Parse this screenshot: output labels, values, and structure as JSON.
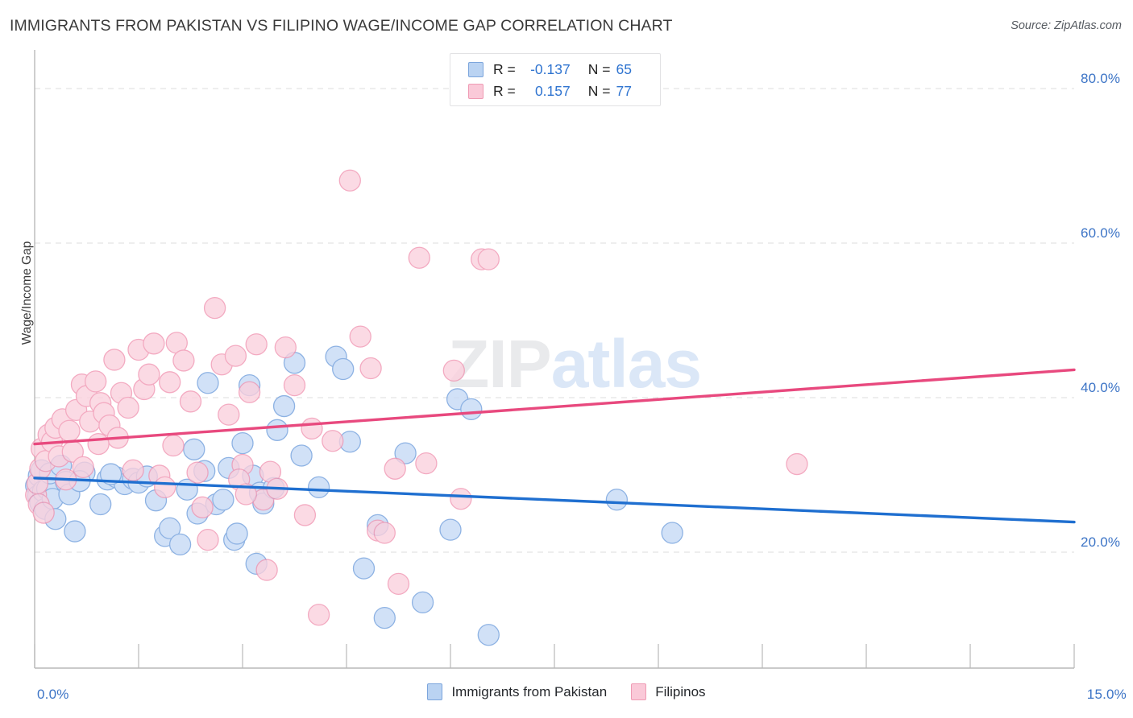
{
  "header": {
    "title": "IMMIGRANTS FROM PAKISTAN VS FILIPINO WAGE/INCOME GAP CORRELATION CHART",
    "source": "Source: ZipAtlas.com"
  },
  "watermark": {
    "part1": "ZIP",
    "part2": "atlas"
  },
  "stats_legend": {
    "rows": [
      {
        "series": "Immigrants from Pakistan",
        "color": "#bad3f2",
        "r_label": "R =",
        "r_value": "-0.137",
        "n_label": "N =",
        "n_value": "65"
      },
      {
        "series": "Filipinos",
        "color": "#fac9d8",
        "r_label": "R =",
        "r_value": "0.157",
        "n_label": "N =",
        "n_value": "77"
      }
    ]
  },
  "bottom_legend": {
    "items": [
      {
        "label": "Immigrants from Pakistan",
        "color": "#bad3f2",
        "border": "#7ca5dc"
      },
      {
        "label": "Filipinos",
        "color": "#fac9d8",
        "border": "#ef9bb4"
      }
    ]
  },
  "chart_data": {
    "type": "scatter",
    "title": "IMMIGRANTS FROM PAKISTAN VS FILIPINO WAGE/INCOME GAP CORRELATION CHART",
    "xlabel": "",
    "ylabel": "Wage/Income Gap",
    "xlim": [
      0,
      15
    ],
    "ylim": [
      5.0,
      85.0
    ],
    "x_ticks": [
      0,
      15
    ],
    "x_tick_labels": [
      "0.0%",
      "15.0%"
    ],
    "y_ticks": [
      20,
      40,
      60,
      80
    ],
    "y_tick_labels": [
      "20.0%",
      "40.0%",
      "60.0%",
      "80.0%"
    ],
    "grid": true,
    "grid_axis": "y",
    "legend_position": "bottom",
    "marker_radius_px": 13,
    "colors": {
      "blue_fill": "#c5d9f5",
      "blue_stroke": "#6e9ddc",
      "pink_fill": "#fbd0dd",
      "pink_stroke": "#f093b0",
      "blue_line": "#1f6fd0",
      "pink_line": "#e8497e",
      "grid": "#dcdcdc",
      "axis": "#b9b9b9",
      "tick_text": "#3c74c6"
    },
    "series": [
      {
        "name": "Immigrants from Pakistan",
        "color": "#c5d9f5",
        "stroke": "#6e9ddc",
        "r": -0.137,
        "n": 65,
        "trendline": {
          "x0": 0,
          "y0": 29.6,
          "x1": 15,
          "y1": 23.9
        },
        "points": [
          [
            0.02,
            28.6
          ],
          [
            0.05,
            27.3
          ],
          [
            0.06,
            29.9
          ],
          [
            0.08,
            26.4
          ],
          [
            0.1,
            30.6
          ],
          [
            0.12,
            27.9
          ],
          [
            0.15,
            25.6
          ],
          [
            0.18,
            28.2
          ],
          [
            0.22,
            30.2
          ],
          [
            0.26,
            26.9
          ],
          [
            0.3,
            24.3
          ],
          [
            0.38,
            31.2
          ],
          [
            0.45,
            29.1
          ],
          [
            0.5,
            27.5
          ],
          [
            0.58,
            22.7
          ],
          [
            0.72,
            30.3
          ],
          [
            0.95,
            26.2
          ],
          [
            1.05,
            29.4
          ],
          [
            1.18,
            29.7
          ],
          [
            1.3,
            28.8
          ],
          [
            1.42,
            29.5
          ],
          [
            1.5,
            29.0
          ],
          [
            1.62,
            29.8
          ],
          [
            1.75,
            26.7
          ],
          [
            1.88,
            22.1
          ],
          [
            1.95,
            23.1
          ],
          [
            2.1,
            21.0
          ],
          [
            2.2,
            28.1
          ],
          [
            2.35,
            25.0
          ],
          [
            2.45,
            30.5
          ],
          [
            2.5,
            41.9
          ],
          [
            2.62,
            26.2
          ],
          [
            2.72,
            26.8
          ],
          [
            2.8,
            30.9
          ],
          [
            2.88,
            21.6
          ],
          [
            2.92,
            22.4
          ],
          [
            3.0,
            34.1
          ],
          [
            3.1,
            41.6
          ],
          [
            3.15,
            29.9
          ],
          [
            3.2,
            18.5
          ],
          [
            3.25,
            27.7
          ],
          [
            3.3,
            26.3
          ],
          [
            3.45,
            28.3
          ],
          [
            3.5,
            35.8
          ],
          [
            3.6,
            38.9
          ],
          [
            3.75,
            44.5
          ],
          [
            3.85,
            32.5
          ],
          [
            4.1,
            28.4
          ],
          [
            4.35,
            45.3
          ],
          [
            4.45,
            43.7
          ],
          [
            4.55,
            34.3
          ],
          [
            4.75,
            17.9
          ],
          [
            4.95,
            23.5
          ],
          [
            5.05,
            11.5
          ],
          [
            5.35,
            32.8
          ],
          [
            5.6,
            13.5
          ],
          [
            6.0,
            22.9
          ],
          [
            6.1,
            39.8
          ],
          [
            6.3,
            38.5
          ],
          [
            6.55,
            9.3
          ],
          [
            8.4,
            26.8
          ],
          [
            9.2,
            22.5
          ],
          [
            2.3,
            33.3
          ],
          [
            1.1,
            30.1
          ],
          [
            0.65,
            29.2
          ]
        ]
      },
      {
        "name": "Filipinos",
        "color": "#fbd0dd",
        "stroke": "#f093b0",
        "r": 0.157,
        "n": 77,
        "trendline": {
          "x0": 0,
          "y0": 34.0,
          "x1": 15,
          "y1": 43.6
        },
        "points": [
          [
            0.02,
            27.4
          ],
          [
            0.04,
            28.9
          ],
          [
            0.06,
            26.2
          ],
          [
            0.08,
            30.8
          ],
          [
            0.1,
            33.4
          ],
          [
            0.13,
            25.1
          ],
          [
            0.16,
            31.8
          ],
          [
            0.2,
            35.2
          ],
          [
            0.25,
            34.3
          ],
          [
            0.3,
            36.1
          ],
          [
            0.35,
            32.4
          ],
          [
            0.4,
            37.2
          ],
          [
            0.45,
            29.4
          ],
          [
            0.5,
            35.7
          ],
          [
            0.6,
            38.4
          ],
          [
            0.68,
            41.7
          ],
          [
            0.75,
            40.2
          ],
          [
            0.8,
            36.9
          ],
          [
            0.88,
            42.1
          ],
          [
            0.95,
            39.3
          ],
          [
            1.0,
            38.0
          ],
          [
            1.08,
            36.4
          ],
          [
            1.15,
            44.9
          ],
          [
            1.25,
            40.6
          ],
          [
            1.35,
            38.7
          ],
          [
            1.42,
            30.6
          ],
          [
            1.5,
            46.2
          ],
          [
            1.58,
            41.1
          ],
          [
            1.65,
            43.0
          ],
          [
            1.72,
            47.0
          ],
          [
            1.8,
            29.9
          ],
          [
            1.88,
            28.4
          ],
          [
            1.95,
            42.0
          ],
          [
            2.05,
            47.1
          ],
          [
            2.15,
            44.8
          ],
          [
            2.25,
            39.5
          ],
          [
            2.35,
            30.3
          ],
          [
            2.42,
            25.8
          ],
          [
            2.5,
            21.6
          ],
          [
            2.6,
            51.6
          ],
          [
            2.7,
            44.3
          ],
          [
            2.8,
            37.8
          ],
          [
            2.9,
            45.4
          ],
          [
            3.0,
            31.3
          ],
          [
            3.1,
            40.7
          ],
          [
            3.2,
            46.9
          ],
          [
            3.3,
            26.8
          ],
          [
            3.35,
            17.7
          ],
          [
            3.4,
            30.4
          ],
          [
            3.5,
            28.2
          ],
          [
            3.62,
            46.5
          ],
          [
            3.75,
            41.6
          ],
          [
            3.9,
            24.8
          ],
          [
            4.0,
            36.0
          ],
          [
            4.1,
            11.9
          ],
          [
            4.3,
            34.4
          ],
          [
            4.55,
            68.1
          ],
          [
            4.7,
            47.9
          ],
          [
            4.85,
            43.8
          ],
          [
            4.95,
            22.8
          ],
          [
            5.05,
            22.5
          ],
          [
            5.2,
            30.8
          ],
          [
            5.25,
            15.9
          ],
          [
            5.55,
            58.1
          ],
          [
            5.65,
            31.5
          ],
          [
            6.05,
            43.5
          ],
          [
            6.15,
            26.9
          ],
          [
            6.45,
            57.9
          ],
          [
            6.55,
            57.9
          ],
          [
            1.2,
            34.8
          ],
          [
            0.55,
            33.0
          ],
          [
            0.92,
            34.0
          ],
          [
            2.0,
            33.8
          ],
          [
            2.95,
            29.4
          ],
          [
            3.05,
            27.5
          ],
          [
            11.0,
            31.4
          ],
          [
            0.7,
            31.0
          ]
        ]
      }
    ]
  }
}
